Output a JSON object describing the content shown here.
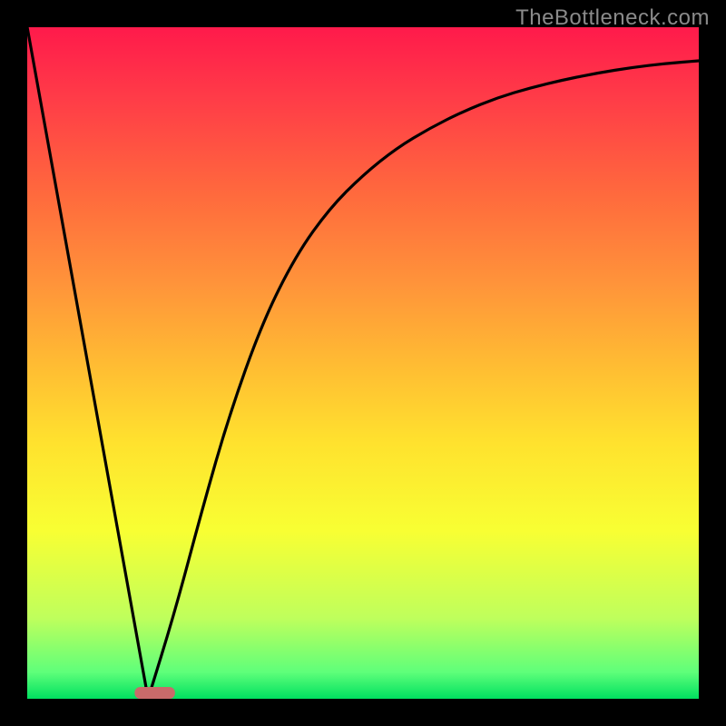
{
  "watermark": "TheBottleneck.com",
  "chart_data": {
    "type": "line",
    "title": "",
    "xlabel": "",
    "ylabel": "",
    "xlim": [
      0,
      100
    ],
    "ylim": [
      0,
      100
    ],
    "grid": false,
    "series": [
      {
        "name": "left-slope",
        "x": [
          0,
          18
        ],
        "values": [
          100,
          0
        ]
      },
      {
        "name": "right-curve",
        "x": [
          18,
          22,
          26,
          30,
          35,
          40,
          45,
          50,
          55,
          60,
          65,
          70,
          75,
          80,
          85,
          90,
          95,
          100
        ],
        "values": [
          0,
          13,
          28,
          42,
          56,
          66,
          73,
          78,
          82,
          85,
          87.5,
          89.5,
          91,
          92.2,
          93.2,
          94,
          94.6,
          95
        ]
      }
    ],
    "marker": {
      "name": "valley-marker",
      "x_range": [
        16,
        22
      ],
      "y": 0,
      "color": "#c96a6a"
    },
    "gradient_stops": [
      {
        "pos": 0.0,
        "color": "#ff1a4b"
      },
      {
        "pos": 0.1,
        "color": "#ff3a48"
      },
      {
        "pos": 0.25,
        "color": "#ff6a3d"
      },
      {
        "pos": 0.38,
        "color": "#ff933a"
      },
      {
        "pos": 0.5,
        "color": "#ffbb33"
      },
      {
        "pos": 0.62,
        "color": "#ffe22e"
      },
      {
        "pos": 0.75,
        "color": "#f8ff33"
      },
      {
        "pos": 0.88,
        "color": "#bfff5c"
      },
      {
        "pos": 0.96,
        "color": "#5fff7a"
      },
      {
        "pos": 1.0,
        "color": "#00e060"
      }
    ]
  }
}
